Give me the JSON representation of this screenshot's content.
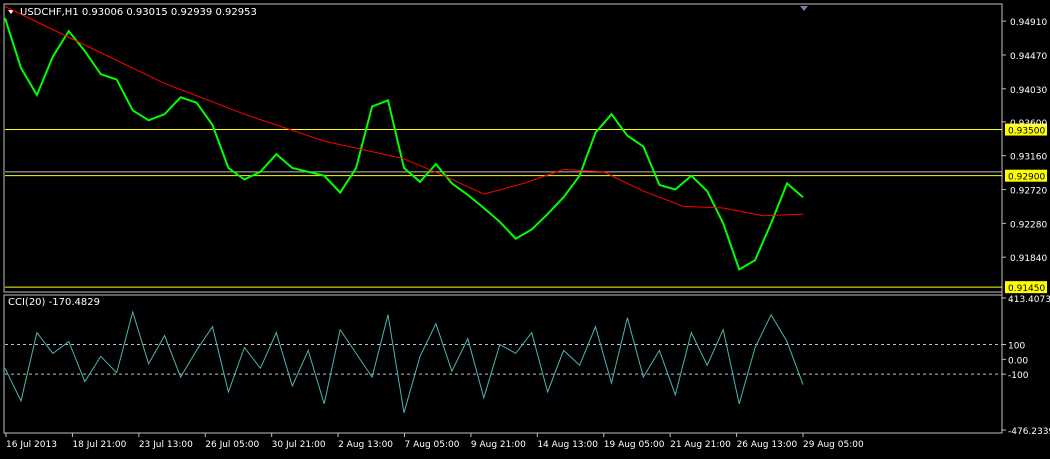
{
  "header": {
    "title": "USDCHF,H1  0.93006 0.93015 0.92939 0.92953"
  },
  "chart_data": [
    {
      "type": "line",
      "title": "USDCHF,H1  0.93006 0.93015 0.92939 0.92953",
      "symbol": "USDCHF",
      "timeframe": "H1",
      "ohlc": {
        "open": "0.93006",
        "high": "0.93015",
        "low": "0.92939",
        "close": "0.92953"
      },
      "ylim": [
        0.914,
        0.9512
      ],
      "y_ticks": [
        "0.94910",
        "0.94470",
        "0.94030",
        "0.93600",
        "0.93160",
        "0.92720",
        "0.92280",
        "0.91840"
      ],
      "x_ticks": [
        "16 Jul 2013",
        "18 Jul 21:00",
        "23 Jul 13:00",
        "26 Jul 05:00",
        "30 Jul 21:00",
        "2 Aug 13:00",
        "7 Aug 05:00",
        "9 Aug 21:00",
        "14 Aug 13:00",
        "19 Aug 05:00",
        "21 Aug 21:00",
        "26 Aug 13:00",
        "29 Aug 05:00"
      ],
      "horizontal_levels": [
        {
          "label": "0.93500",
          "value": 0.935,
          "color": "#ffff00"
        },
        {
          "label": "0.92900",
          "value": 0.929,
          "color": "#ffff00"
        },
        {
          "label": "0.91450",
          "value": 0.9145,
          "color": "#ffff00"
        },
        {
          "value": 0.9295,
          "color": "#c0c0c0"
        }
      ],
      "series": [
        {
          "color": "#00ff00",
          "x": [
            0,
            0.02,
            0.04,
            0.06,
            0.08,
            0.1,
            0.12,
            0.14,
            0.16,
            0.18,
            0.2,
            0.22,
            0.24,
            0.26,
            0.28,
            0.3,
            0.32,
            0.34,
            0.36,
            0.38,
            0.4,
            0.42,
            0.44,
            0.46,
            0.48,
            0.5,
            0.52,
            0.54,
            0.56,
            0.58,
            0.6,
            0.62,
            0.64,
            0.66,
            0.68,
            0.7,
            0.72,
            0.74,
            0.76,
            0.78,
            0.8,
            0.82,
            0.84,
            0.86,
            0.88,
            0.9,
            0.92,
            0.94,
            0.96,
            0.98,
            1.0
          ],
          "values": [
            0.9495,
            0.943,
            0.9395,
            0.9445,
            0.9478,
            0.9452,
            0.9422,
            0.9415,
            0.9375,
            0.9362,
            0.937,
            0.9392,
            0.9385,
            0.9356,
            0.93,
            0.9285,
            0.9295,
            0.9318,
            0.93,
            0.9295,
            0.929,
            0.9268,
            0.93,
            0.938,
            0.9388,
            0.93,
            0.9282,
            0.9305,
            0.928,
            0.9265,
            0.9248,
            0.923,
            0.9208,
            0.922,
            0.924,
            0.9262,
            0.929,
            0.9346,
            0.937,
            0.9342,
            0.9328,
            0.9278,
            0.9272,
            0.929,
            0.927,
            0.9228,
            0.9168,
            0.918,
            0.9228,
            0.928,
            0.9262
          ]
        },
        {
          "color": "#ff0000",
          "x": [
            0.0,
            0.1,
            0.2,
            0.3,
            0.4,
            0.5,
            0.55,
            0.6,
            0.65,
            0.7,
            0.75,
            0.8,
            0.85,
            0.9,
            0.95,
            1.0
          ],
          "values": [
            0.951,
            0.946,
            0.941,
            0.937,
            0.9335,
            0.9312,
            0.929,
            0.9266,
            0.928,
            0.9298,
            0.9295,
            0.927,
            0.925,
            0.9248,
            0.9238,
            0.924
          ]
        }
      ]
    },
    {
      "type": "line",
      "title": "CCI(20) -170.4829",
      "indicator": "CCI(20)",
      "last_value": "-170.4829",
      "y_ticks": [
        "413.4073",
        "100",
        "0.00",
        "-100",
        "-476.2339"
      ],
      "ylim": [
        -476.2339,
        413.4073
      ],
      "levels": [
        100,
        -100
      ],
      "series": [
        {
          "color": "#4fb3b3",
          "x": [
            0,
            0.02,
            0.04,
            0.06,
            0.08,
            0.1,
            0.12,
            0.14,
            0.16,
            0.18,
            0.2,
            0.22,
            0.24,
            0.26,
            0.28,
            0.3,
            0.32,
            0.34,
            0.36,
            0.38,
            0.4,
            0.42,
            0.44,
            0.46,
            0.48,
            0.5,
            0.52,
            0.54,
            0.56,
            0.58,
            0.6,
            0.62,
            0.64,
            0.66,
            0.68,
            0.7,
            0.72,
            0.74,
            0.76,
            0.78,
            0.8,
            0.82,
            0.84,
            0.86,
            0.88,
            0.9,
            0.92,
            0.94,
            0.96,
            0.98,
            1.0
          ],
          "values": [
            -60,
            -280,
            180,
            40,
            120,
            -150,
            20,
            -90,
            320,
            -30,
            160,
            -120,
            60,
            220,
            -220,
            80,
            -60,
            180,
            -180,
            60,
            -300,
            200,
            40,
            -120,
            300,
            -360,
            20,
            240,
            -80,
            140,
            -260,
            100,
            40,
            180,
            -220,
            60,
            -40,
            220,
            -160,
            280,
            -120,
            60,
            -240,
            180,
            -40,
            200,
            -300,
            80,
            300,
            120,
            -170
          ]
        }
      ]
    }
  ]
}
